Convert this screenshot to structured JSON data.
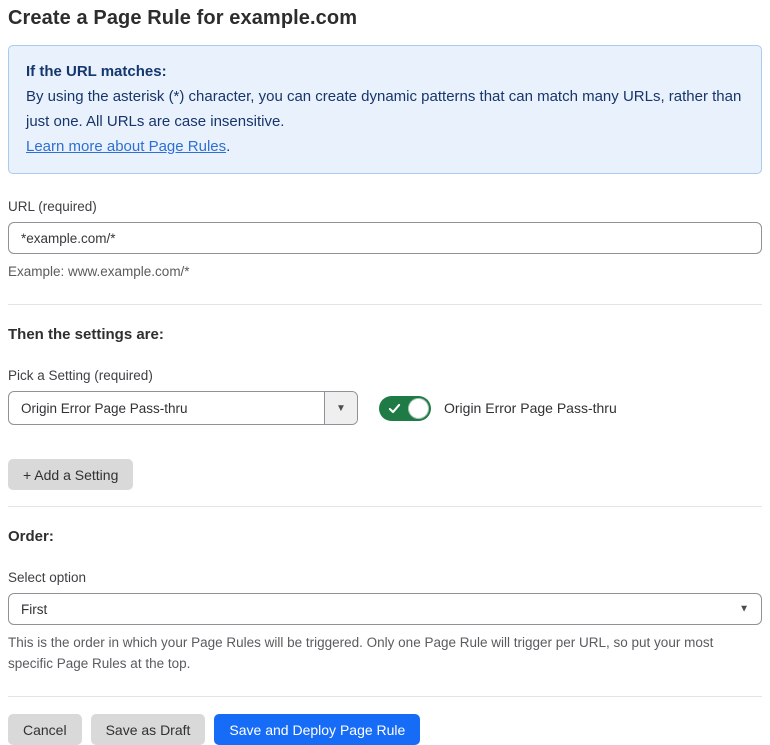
{
  "page": {
    "title": "Create a Page Rule for example.com"
  },
  "info_box": {
    "heading": "If the URL matches:",
    "body": "By using the asterisk (*) character, you can create dynamic patterns that can match many URLs, rather than just one. All URLs are case insensitive.",
    "link_label": "Learn more about Page Rules",
    "link_suffix": "."
  },
  "url_field": {
    "label": "URL (required)",
    "value": "*example.com/*",
    "helper": "Example: www.example.com/*"
  },
  "settings_section": {
    "heading": "Then the settings are:",
    "picker_label": "Pick a Setting (required)",
    "picker_value": "Origin Error Page Pass-thru",
    "picker_arrow": "▼",
    "toggle_state": "on",
    "toggle_label": "Origin Error Page Pass-thru",
    "add_button_label": "+ Add a Setting"
  },
  "order_section": {
    "heading": "Order:",
    "select_label": "Select option",
    "select_value": "First",
    "select_arrow": "▼",
    "helper": "This is the order in which your Page Rules will be triggered. Only one Page Rule will trigger per URL, so put your most specific Page Rules at the top."
  },
  "footer": {
    "cancel_label": "Cancel",
    "save_draft_label": "Save as Draft",
    "save_deploy_label": "Save and Deploy Page Rule"
  },
  "colors": {
    "primary_blue": "#176cf7",
    "toggle_green": "#1f7b45",
    "info_background": "#e9f2fc",
    "info_border": "#aacbec",
    "info_text": "#17356b",
    "link_blue": "#2e6fd4",
    "button_gray": "#d9d9d9"
  }
}
